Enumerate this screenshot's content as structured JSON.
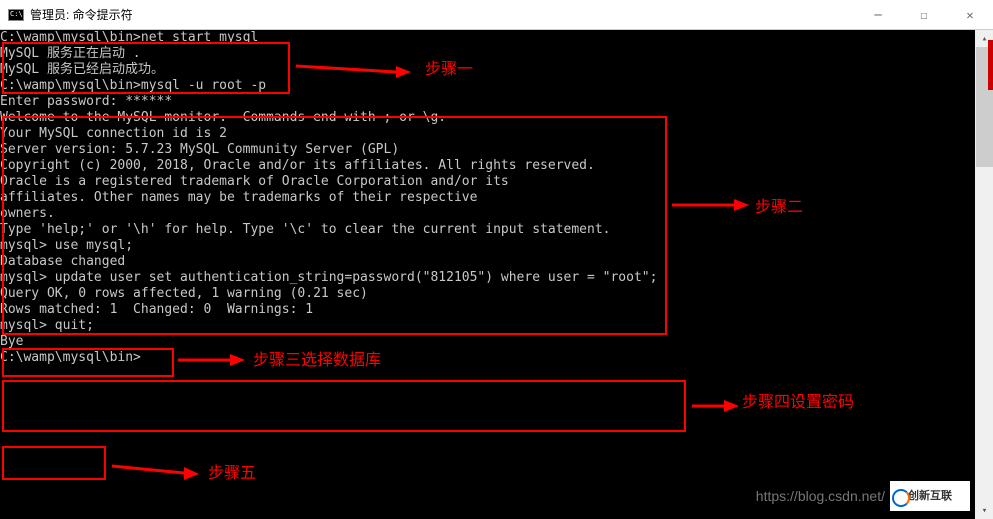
{
  "window": {
    "title": "管理员: 命令提示符"
  },
  "terminal_lines": {
    "l1": "",
    "l2": "C:\\wamp\\mysql\\bin>net start mysql",
    "l3": "MySQL 服务正在启动 .",
    "l4": "MySQL 服务已经启动成功。",
    "l5": "",
    "l6": "",
    "l7": "C:\\wamp\\mysql\\bin>mysql -u root -p",
    "l8": "Enter password: ******",
    "l9": "Welcome to the MySQL monitor.  Commands end with ; or \\g.",
    "l10": "Your MySQL connection id is 2",
    "l11": "Server version: 5.7.23 MySQL Community Server (GPL)",
    "l12": "",
    "l13": "Copyright (c) 2000, 2018, Oracle and/or its affiliates. All rights reserved.",
    "l14": "",
    "l15": "Oracle is a registered trademark of Oracle Corporation and/or its",
    "l16": "affiliates. Other names may be trademarks of their respective",
    "l17": "owners.",
    "l18": "",
    "l19": "Type 'help;' or '\\h' for help. Type '\\c' to clear the current input statement.",
    "l20": "",
    "l21": "mysql> use mysql;",
    "l22": "Database changed",
    "l23": "mysql> update user set authentication_string=password(\"812105\") where user = \"root\";",
    "l24": "Query OK, 0 rows affected, 1 warning (0.21 sec)",
    "l25": "Rows matched: 1  Changed: 0  Warnings: 1",
    "l26": "",
    "l27": "mysql> quit;",
    "l28": "Bye",
    "l29": "",
    "l30": "C:\\wamp\\mysql\\bin>"
  },
  "labels": {
    "step1": "步骤一",
    "step2": "步骤二",
    "step3": "步骤三选择数据库",
    "step4": "步骤四设置密码",
    "step5": "步骤五"
  },
  "watermark": "https://blog.csdn.net/",
  "logo_text": "创新互联"
}
